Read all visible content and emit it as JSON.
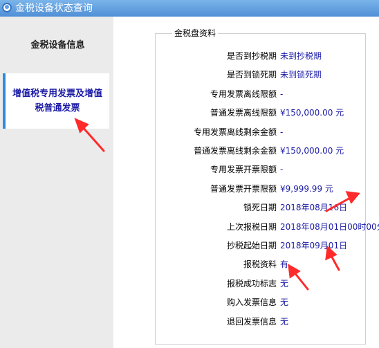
{
  "window": {
    "title": "金税设备状态查询"
  },
  "nav": [
    {
      "label": "金税设备信息"
    },
    {
      "label": "增值税专用发票及增值税普通发票"
    }
  ],
  "section": {
    "legend": "金税盘资料"
  },
  "rows": [
    {
      "label": "是否到抄税期",
      "value": "未到抄税期"
    },
    {
      "label": "是否到锁死期",
      "value": "未到锁死期"
    },
    {
      "label": "专用发票离线限额",
      "value": "-"
    },
    {
      "label": "普通发票离线限额",
      "value": "¥150,000.00 元"
    },
    {
      "label": "专用发票离线剩余金额",
      "value": "-"
    },
    {
      "label": "普通发票离线剩余金额",
      "value": "¥150,000.00 元"
    },
    {
      "label": "专用发票开票限额",
      "value": "-"
    },
    {
      "label": "普通发票开票限额",
      "value": "¥9,999.99 元"
    },
    {
      "label": "锁死日期",
      "value": "2018年08月16日"
    },
    {
      "label": "上次报税日期",
      "value": "2018年08月01日00时00分"
    },
    {
      "label": "抄税起始日期",
      "value": "2018年09月01日"
    },
    {
      "label": "报税资料",
      "value": "有"
    },
    {
      "label": "报税成功标志",
      "value": "无"
    },
    {
      "label": "购入发票信息",
      "value": "无"
    },
    {
      "label": "退回发票信息",
      "value": "无"
    }
  ],
  "colors": {
    "accent": "#2d8be0",
    "annotation": "#ff2a2a",
    "value_text": "#1a1aa6"
  }
}
